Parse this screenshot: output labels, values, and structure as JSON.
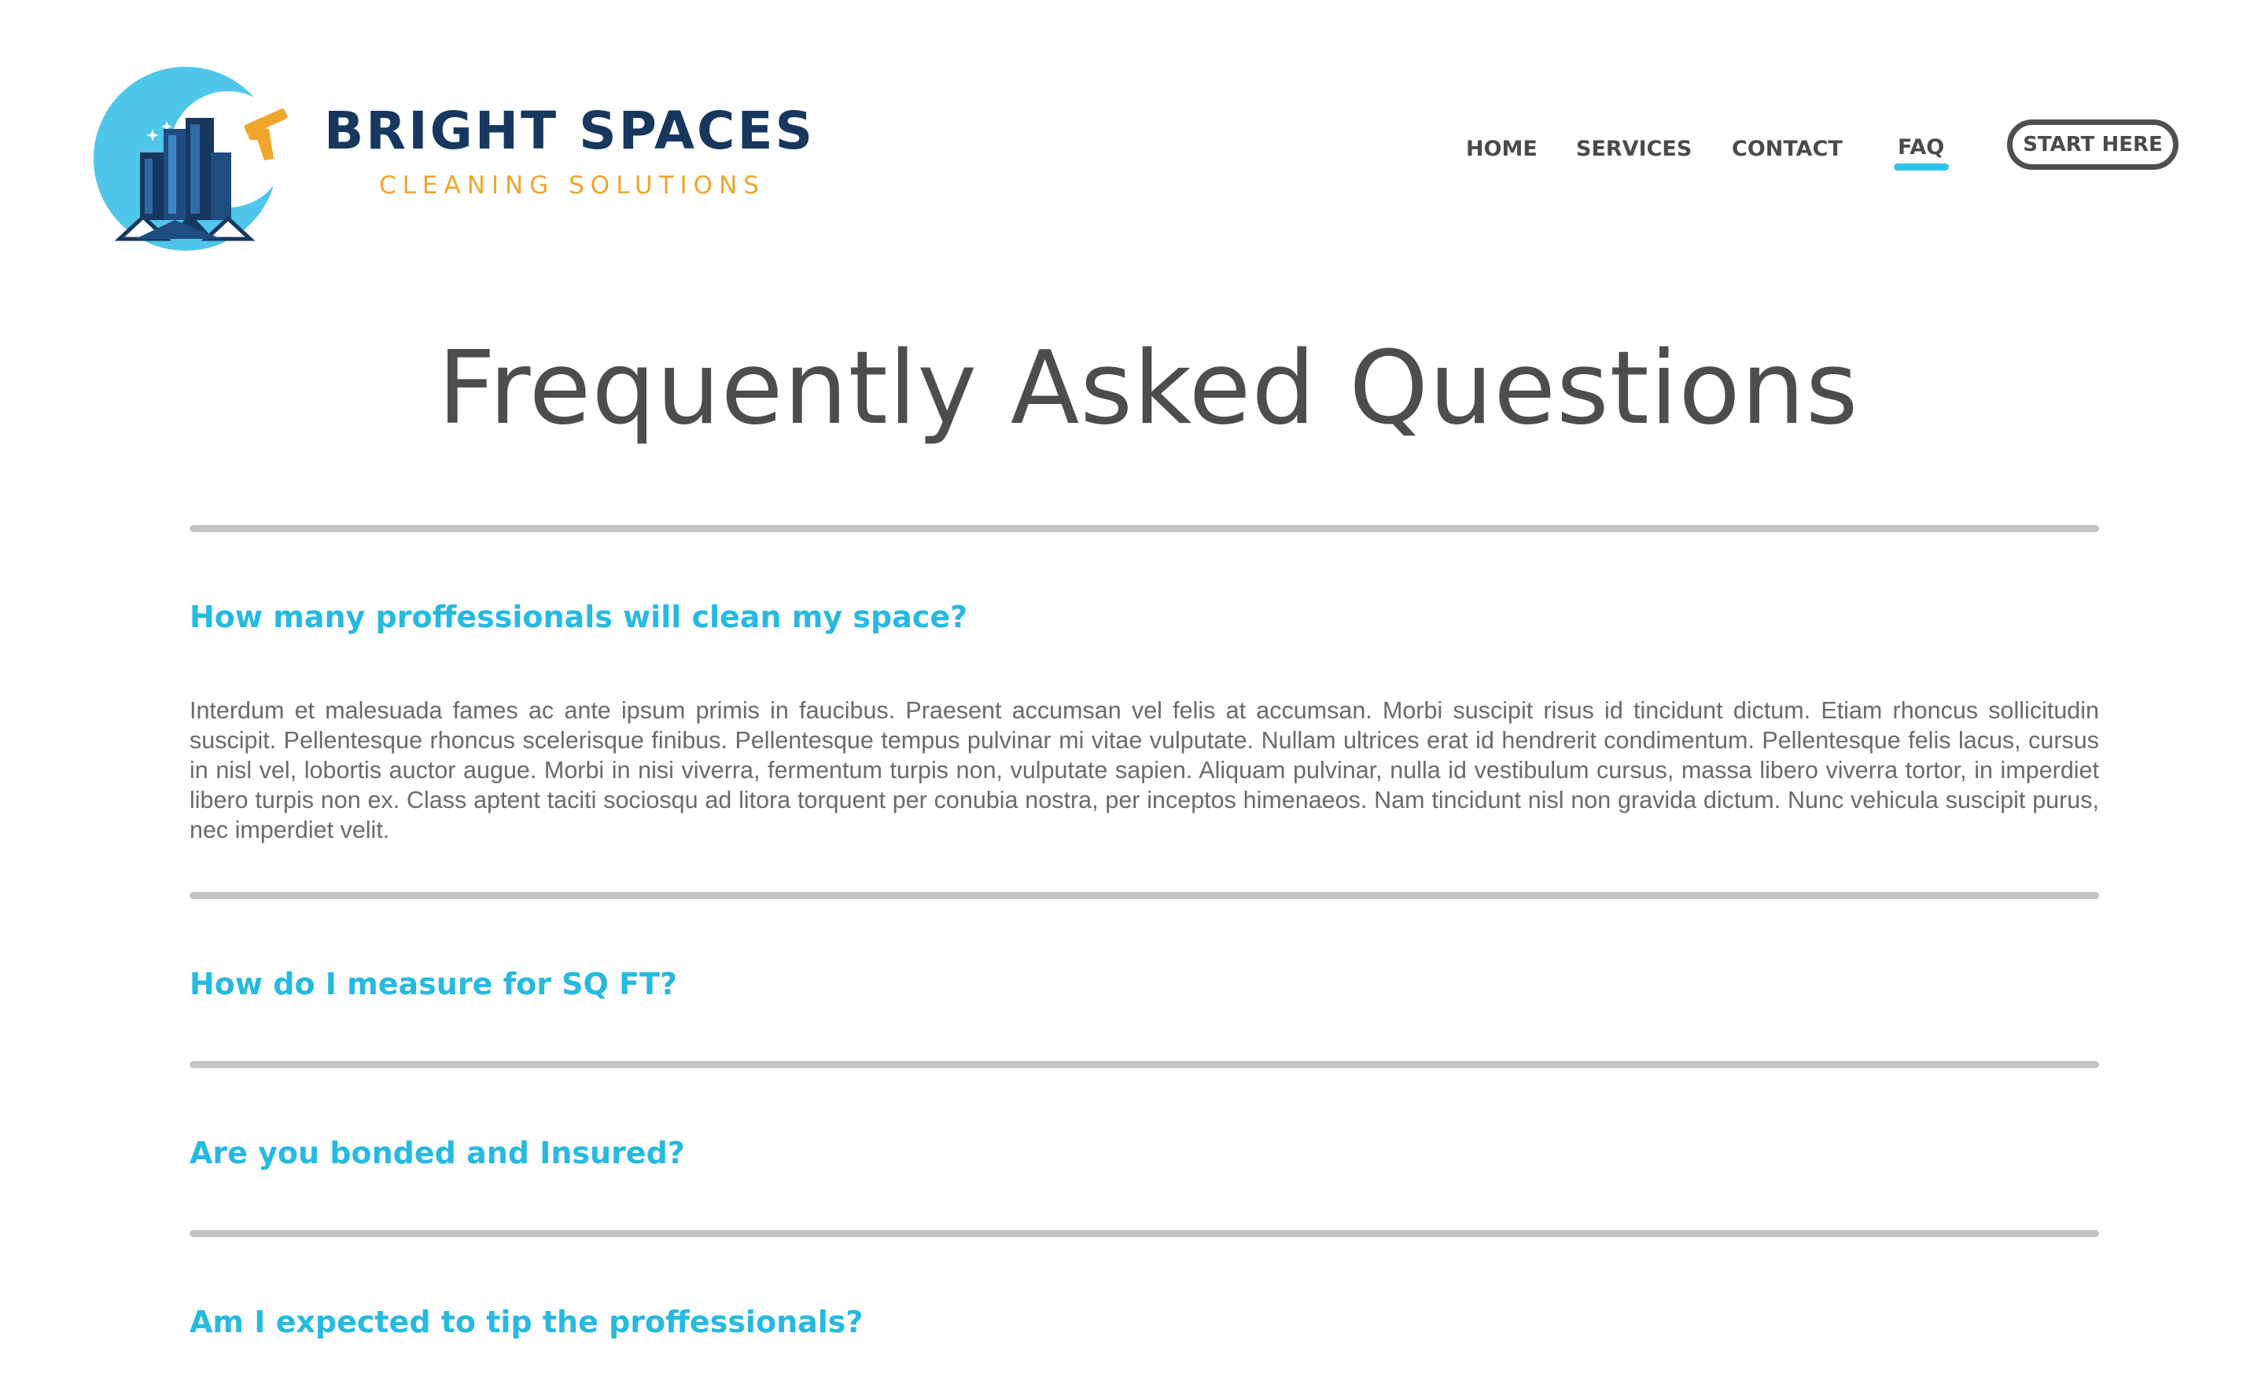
{
  "brand": {
    "name": "BRIGHT SPACES",
    "tagline": "CLEANING SOLUTIONS",
    "logo_icon": "building-squeegee-logo",
    "colors": {
      "navy": "#17375e",
      "orange": "#f0a52b",
      "cyan": "#2fc3e8"
    }
  },
  "nav": {
    "items": [
      {
        "label": "HOME"
      },
      {
        "label": "SERVICES"
      },
      {
        "label": "CONTACT"
      },
      {
        "label": "FAQ",
        "active": true
      }
    ],
    "cta_label": "START HERE"
  },
  "main": {
    "title": "Frequently Asked Questions",
    "faqs": [
      {
        "question": "How many proffessionals will clean my space?",
        "expanded": true,
        "answer": "Interdum et malesuada fames ac ante ipsum primis in faucibus. Praesent accumsan vel felis at accumsan. Morbi suscipit risus id tincidunt dictum. Etiam rhoncus sollicitudin suscipit. Pellentesque rhoncus scelerisque finibus. Pellentesque tempus pulvinar mi vitae vulputate. Nullam ultrices erat id hendrerit condimentum. Pellentesque felis lacus, cursus in nisl vel, lobortis auctor augue. Morbi in nisi viverra, fermentum turpis non, vulputate sapien. Aliquam pulvinar, nulla id vestibulum cursus, massa libero viverra tortor, in imperdiet libero turpis non ex. Class aptent taciti sociosqu ad litora torquent per conubia nostra, per inceptos himenaeos. Nam tincidunt nisl non gravida dictum. Nunc vehicula suscipit purus, nec imperdiet velit."
      },
      {
        "question": "How do I measure for SQ FT?",
        "expanded": false
      },
      {
        "question": "Are you bonded and Insured?",
        "expanded": false
      },
      {
        "question": "Am I expected to tip the proffessionals?",
        "expanded": false
      }
    ]
  }
}
